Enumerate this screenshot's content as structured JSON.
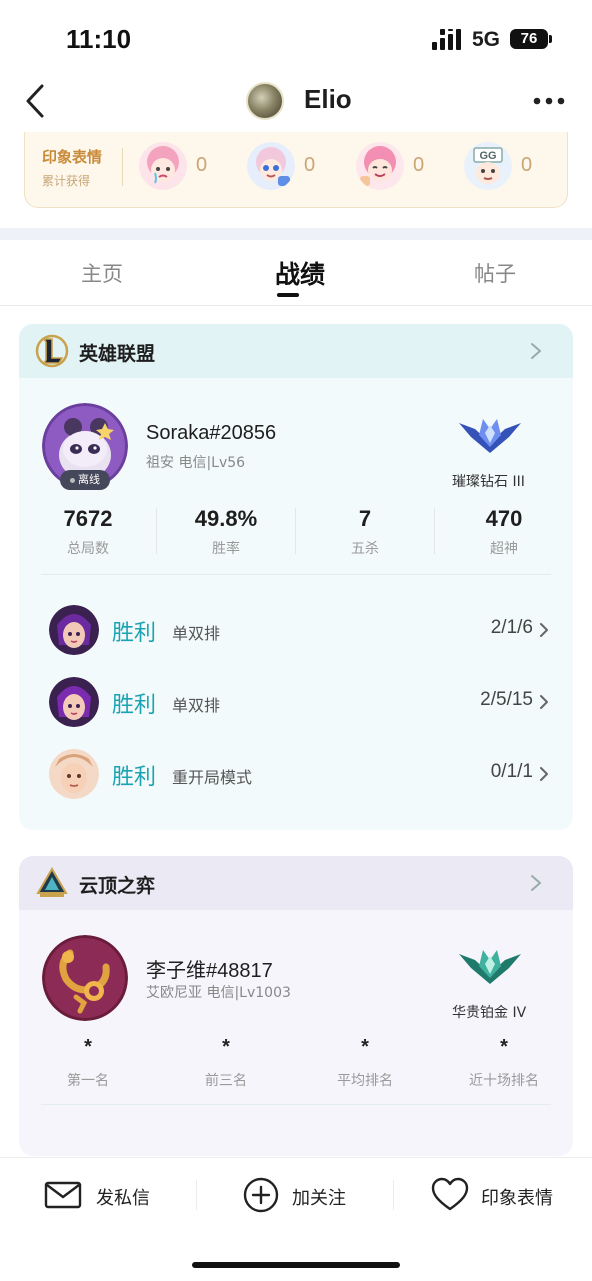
{
  "status_bar": {
    "time": "11:10",
    "network": "5G",
    "battery": "76"
  },
  "header": {
    "title": "Elio"
  },
  "impression": {
    "title": "印象表情",
    "subtitle": "累计获得",
    "emotes": [
      {
        "icon": "crying-girl-emote",
        "count": "0"
      },
      {
        "icon": "blue-hair-pointing-emote",
        "count": "0"
      },
      {
        "icon": "pink-hair-thumbsup-emote",
        "count": "0"
      },
      {
        "icon": "gg-sign-emote",
        "count": "0"
      }
    ]
  },
  "tabs": [
    {
      "label": "主页",
      "active": false
    },
    {
      "label": "战绩",
      "active": true
    },
    {
      "label": "帖子",
      "active": false
    }
  ],
  "lol": {
    "game_name": "英雄联盟",
    "player_name": "Soraka#20856",
    "server": "祖安 电信|Lv56",
    "status": "离线",
    "rank": "璀璨钻石 III",
    "stats": [
      {
        "value": "7672",
        "label": "总局数"
      },
      {
        "value": "49.8%",
        "label": "胜率"
      },
      {
        "value": "7",
        "label": "五杀"
      },
      {
        "value": "470",
        "label": "超神"
      }
    ],
    "matches": [
      {
        "result": "胜利",
        "mode": "单双排",
        "kda": "2/1/6"
      },
      {
        "result": "胜利",
        "mode": "单双排",
        "kda": "2/5/15"
      },
      {
        "result": "胜利",
        "mode": "重开局模式",
        "kda": "0/1/1"
      }
    ]
  },
  "tft": {
    "game_name": "云顶之弈",
    "player_name": "李子维#48817",
    "server": "艾欧尼亚 电信|Lv1003",
    "rank": "华贵铂金 IV",
    "stats": [
      {
        "value": "*",
        "label": "第一名"
      },
      {
        "value": "*",
        "label": "前三名"
      },
      {
        "value": "*",
        "label": "平均排名"
      },
      {
        "value": "*",
        "label": "近十场排名"
      }
    ]
  },
  "bottom_actions": [
    {
      "label": "发私信",
      "icon": "mail-icon"
    },
    {
      "label": "加关注",
      "icon": "plus-circle-icon"
    },
    {
      "label": "印象表情",
      "icon": "heart-icon"
    }
  ],
  "colors": {
    "win": "#1aa3b1",
    "accent_gold": "#c98b3a",
    "lol_header": "#e2f3f5",
    "tft_header": "#ebe9f4"
  }
}
